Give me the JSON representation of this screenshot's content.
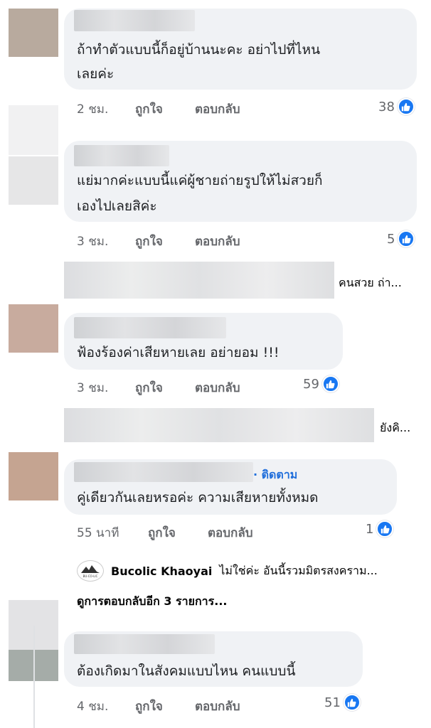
{
  "colors": {
    "like_blue": "#1877f2",
    "follow_blue": "#216fdb",
    "bubble_bg": "#f0f2f5",
    "meta_gray": "#65676b"
  },
  "comments": [
    {
      "text_lines": [
        "ถ้าทำตัวแบบนี้ก็อยู่บ้านนะคะ อย่าไปที่ไหน",
        "เลยค่ะ"
      ],
      "time": "2 ชม.",
      "like_action": "ถูกใจ",
      "reply_action": "ตอบกลับ",
      "reactions": "38"
    },
    {
      "text_lines": [
        "แย่มากค่ะแบบนี้แค่ผู้ชายถ่ายรูปให้ไม่สวยก็",
        "เองไปเลยสิค่ะ"
      ],
      "time": "3 ชม.",
      "like_action": "ถูกใจ",
      "reply_action": "ตอบกลับ",
      "reactions": "5"
    },
    {
      "text_lines": [
        "ฟ้องร้องค่าเสียหายเลย อย่ายอม !!!"
      ],
      "time": "3 ชม.",
      "like_action": "ถูกใจ",
      "reply_action": "ตอบกลับ",
      "reactions": "59"
    },
    {
      "text_lines": [
        "คู่เดียวกันเลยหรอค่ะ ความเสียหายทั้งหมด"
      ],
      "time": "55 นาที",
      "like_action": "ถูกใจ",
      "reply_action": "ตอบกลับ",
      "reactions": "1",
      "follow_label": "· ติดตาม"
    },
    {
      "text_lines": [
        "ต้องเกิดมาในสังคมแบบไหน คนแบบนี้"
      ],
      "time": "4 ชม.",
      "like_action": "ถูกใจ",
      "reply_action": "ตอบกลับ",
      "reactions": "51"
    }
  ],
  "reply_previews": [
    "คนสวย ถ่า...",
    "ยังคิ..."
  ],
  "page_reply": {
    "logo_text": "BU-CO-LIC",
    "name": "Bucolic Khaoyai",
    "text": "ไม่ใช่ค่ะ อันนี้รวมมิตรสงคราม..."
  },
  "more_replies": "ดูการตอบกลับอีก 3 รายการ...",
  "icons": {
    "like": "thumbs-up-icon",
    "page_logo": "mountain-logo-icon"
  }
}
